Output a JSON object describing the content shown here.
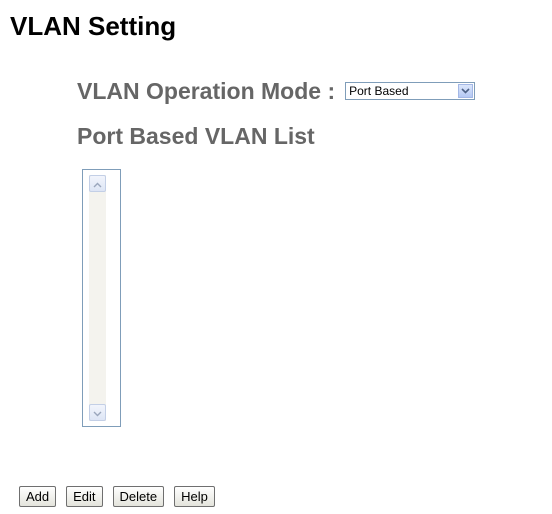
{
  "page": {
    "title": "VLAN Setting"
  },
  "operation_mode": {
    "label": "VLAN Operation Mode :",
    "selected": "Port Based"
  },
  "vlan_list": {
    "heading": "Port Based VLAN List",
    "items": []
  },
  "buttons": {
    "add": "Add",
    "edit": "Edit",
    "delete": "Delete",
    "help": "Help"
  },
  "colors": {
    "heading_gray": "#666666",
    "title": "#000000",
    "select_border": "#7f9db9"
  },
  "icons": {
    "select_arrow": "chevron-down-icon",
    "scroll_up": "chevron-up-icon",
    "scroll_down": "chevron-down-icon"
  }
}
